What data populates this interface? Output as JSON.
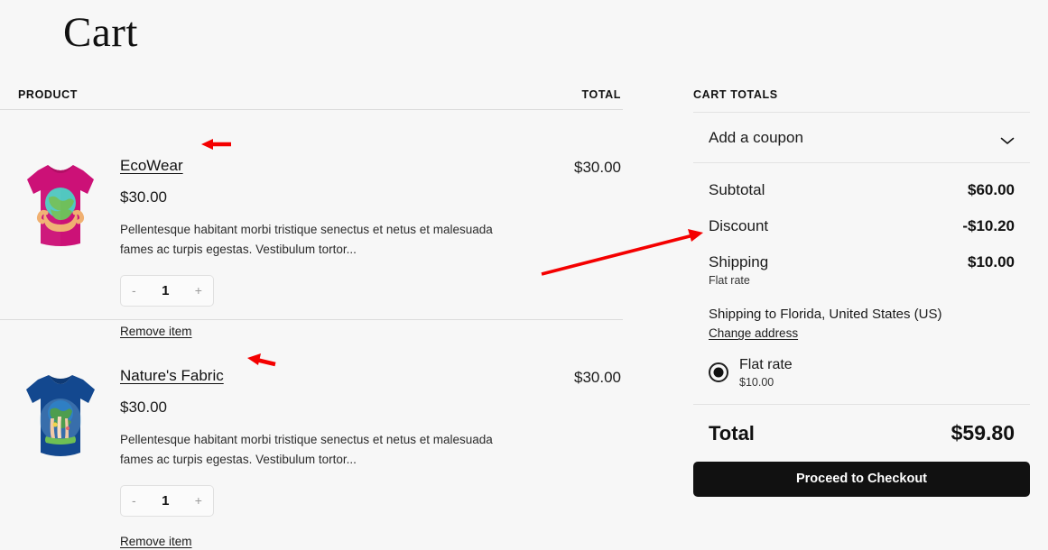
{
  "page": {
    "title": "Cart"
  },
  "table": {
    "col_product": "PRODUCT",
    "col_total": "TOTAL"
  },
  "items": [
    {
      "name": "EcoWear",
      "price": "$30.00",
      "description": "Pellentesque habitant morbi tristique senectus et netus et malesuada fames ac turpis egestas. Vestibulum tortor...",
      "qty": "1",
      "minus": "-",
      "plus": "+",
      "remove_label": "Remove item",
      "line_total": "$30.00",
      "shirt_color": "#cc1177",
      "thumb_name": "ecowear-tshirt-thumbnail"
    },
    {
      "name": "Nature's Fabric",
      "price": "$30.00",
      "description": "Pellentesque habitant morbi tristique senectus et netus et malesuada fames ac turpis egestas. Vestibulum tortor...",
      "qty": "1",
      "minus": "-",
      "plus": "+",
      "remove_label": "Remove item",
      "line_total": "$30.00",
      "shirt_color": "#13488f",
      "thumb_name": "natures-fabric-tshirt-thumbnail"
    }
  ],
  "totals": {
    "title": "CART TOTALS",
    "coupon_label": "Add a coupon",
    "subtotal_label": "Subtotal",
    "subtotal_value": "$60.00",
    "discount_label": "Discount",
    "discount_value": "-$10.20",
    "shipping_label": "Shipping",
    "shipping_value": "$10.00",
    "shipping_note": "Flat rate",
    "shipping_to": "Shipping to Florida, United States (US)",
    "change_address": "Change address",
    "shipping_option_name": "Flat rate",
    "shipping_option_price": "$10.00",
    "total_label": "Total",
    "total_value": "$59.80",
    "checkout_label": "Proceed to Checkout"
  },
  "annotations": {
    "color": "#f40000",
    "arrows": [
      {
        "name": "arrow-to-ecowear",
        "points": "to EcoWear product name"
      },
      {
        "name": "arrow-to-natures-fabric",
        "points": "to Nature's Fabric product name"
      },
      {
        "name": "arrow-to-discount",
        "points": "to Discount row"
      }
    ]
  }
}
